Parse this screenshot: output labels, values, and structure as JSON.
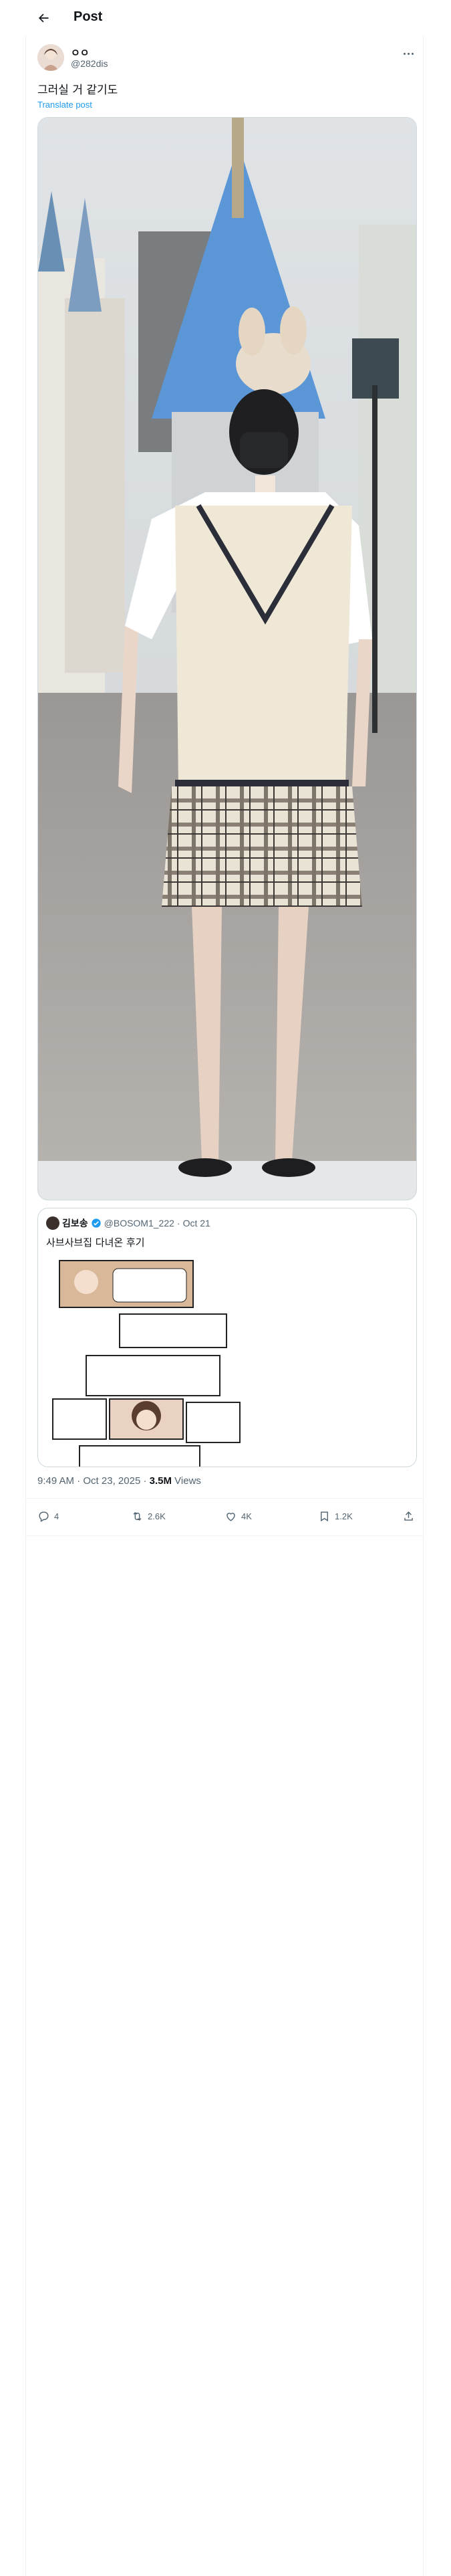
{
  "header": {
    "title": "Post"
  },
  "author": {
    "display_name": "ㅇㅇ",
    "handle": "@282dis"
  },
  "tweet": {
    "text": "그러실 거 같기도",
    "translate_label": "Translate post"
  },
  "quote": {
    "name": "김보송",
    "handle": "@BOSOM1_222",
    "separator": "·",
    "date": "Oct 21",
    "text": "사브사브집 다녀온 후기"
  },
  "meta": {
    "time": "9:49 AM",
    "separator": "·",
    "date": "Oct 23, 2025",
    "views_count": "3.5M",
    "views_label": "Views"
  },
  "actions": {
    "replies": "4",
    "reposts": "2.6K",
    "likes": "4K",
    "bookmarks": "1.2K"
  },
  "colors": {
    "accent": "#1d9bf0",
    "verified": "#1d9bf0",
    "text": "#0f1419",
    "muted": "#536471"
  },
  "icons": [
    "back-arrow-icon",
    "more-icon",
    "verified-icon",
    "reply-icon",
    "repost-icon",
    "like-icon",
    "bookmark-icon",
    "share-icon"
  ]
}
